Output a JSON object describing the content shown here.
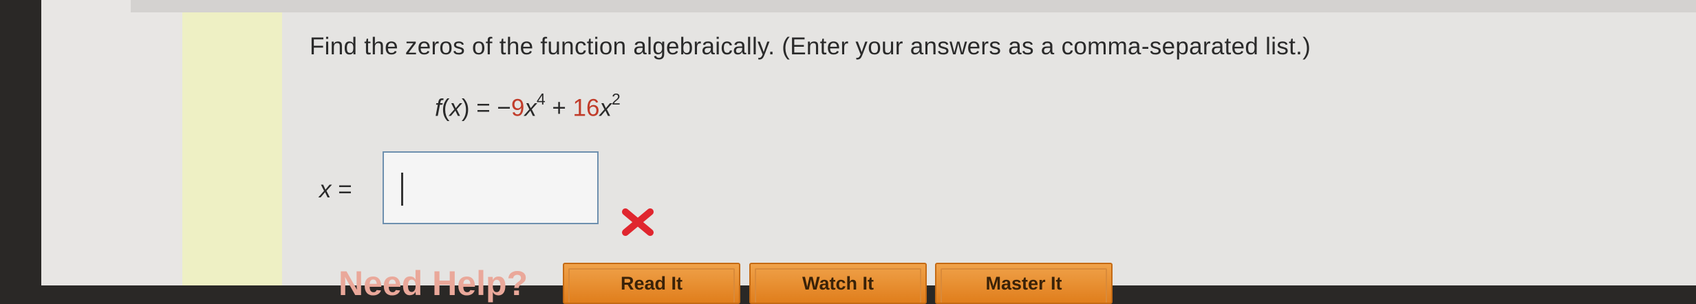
{
  "question": {
    "prompt": "Find the zeros of the function algebraically. (Enter your answers as a comma-separated list.)"
  },
  "equation": {
    "fname": "f",
    "open_paren": "(",
    "fvar": "x",
    "close_eq": ") = −",
    "coef1": "9",
    "var1": "x",
    "exp1": "4",
    "plus": " + ",
    "coef2": "16",
    "var2": "x",
    "exp2": "2"
  },
  "answer": {
    "var": "x",
    "equals": " =",
    "value": "",
    "status_icon": "incorrect-x-icon",
    "status_color": "#e0262f"
  },
  "help": {
    "heading": "Need Help?",
    "buttons": [
      "Read It",
      "Watch It",
      "Master It"
    ],
    "button_color": "#e8902e"
  }
}
